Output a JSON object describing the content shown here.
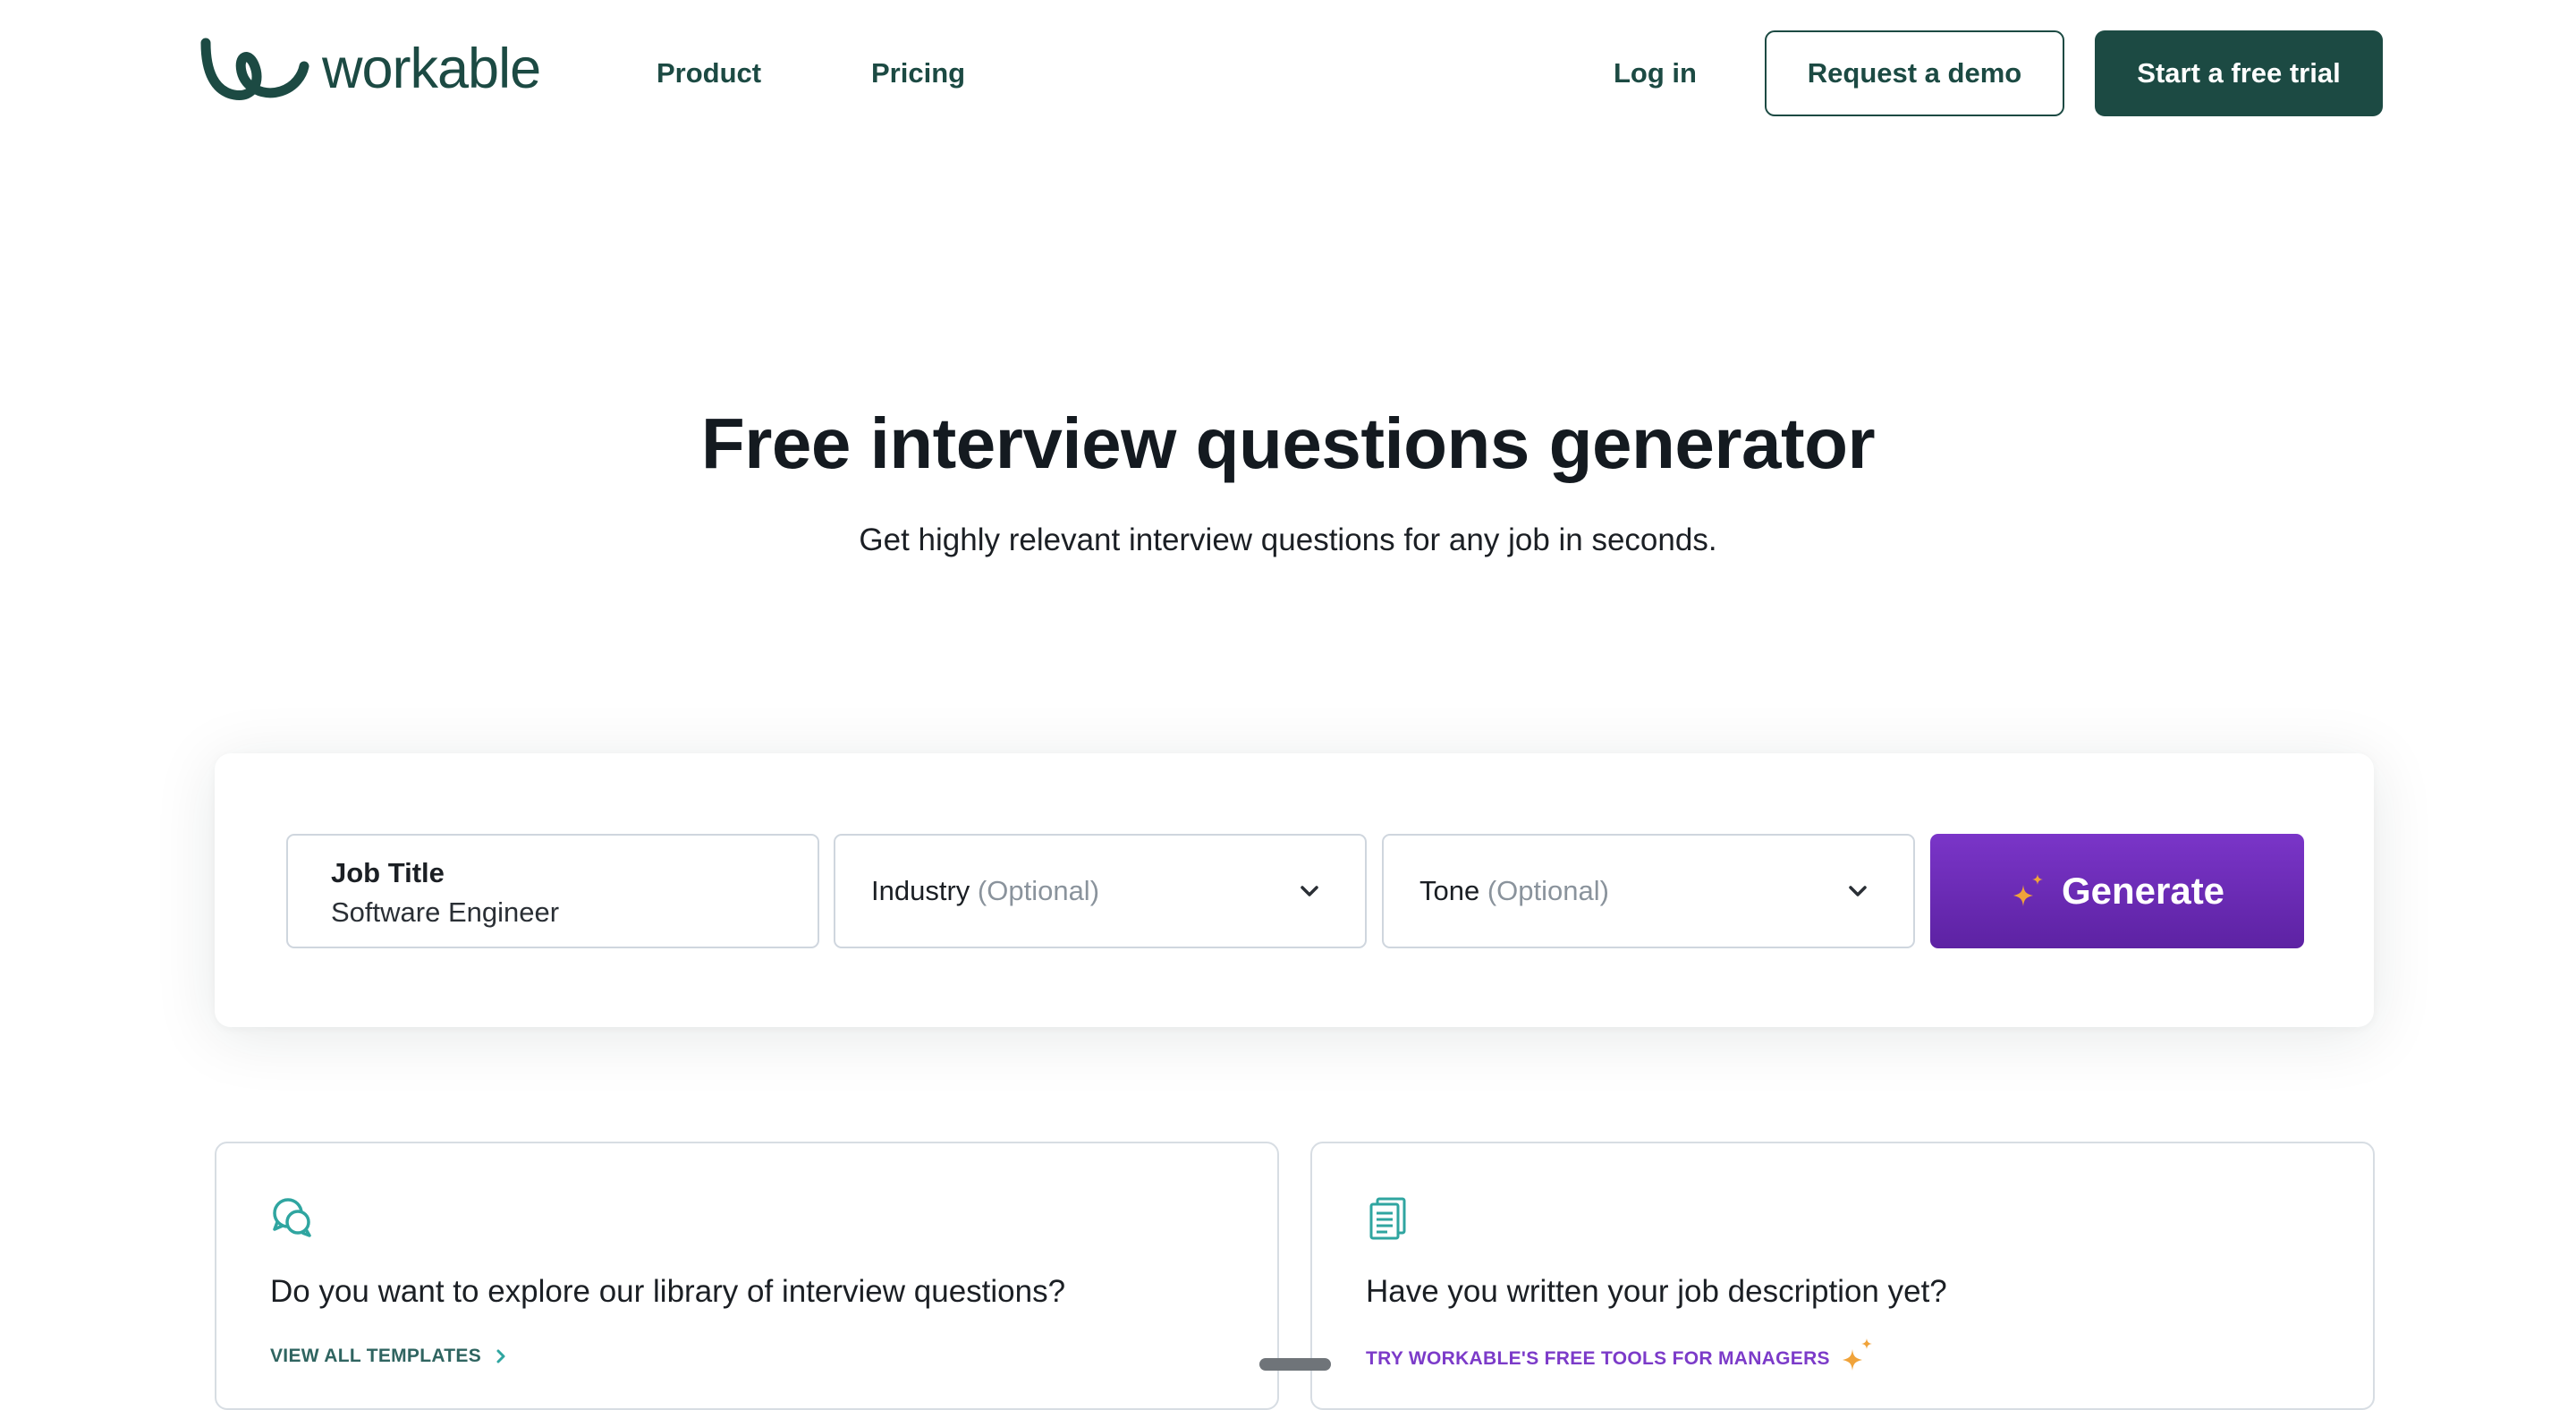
{
  "header": {
    "logo_text": "workable",
    "nav": {
      "product": "Product",
      "pricing": "Pricing",
      "login": "Log in"
    },
    "request_demo": "Request a demo",
    "start_trial": "Start a free trial"
  },
  "hero": {
    "title": "Free interview questions generator",
    "subtitle": "Get highly relevant interview questions for any job in seconds."
  },
  "form": {
    "job_title": {
      "label": "Job Title",
      "value": "Software Engineer"
    },
    "industry": {
      "label": "Industry",
      "optional": "(Optional)"
    },
    "tone": {
      "label": "Tone",
      "optional": "(Optional)"
    },
    "generate_label": "Generate"
  },
  "cards": {
    "library": {
      "icon": "chat-bubbles-icon",
      "title": "Do you want to explore our library of interview questions?",
      "link": "VIEW ALL TEMPLATES"
    },
    "job_description": {
      "icon": "document-icon",
      "title": "Have you written your job description yet?",
      "link": "TRY WORKABLE'S FREE TOOLS FOR MANAGERS"
    }
  },
  "colors": {
    "brand_green": "#1c4a43",
    "generate_purple": "#6a2bb6",
    "accent_teal": "#2fa5a0",
    "spark_orange": "#f0a33a",
    "link_purple": "#7c3bc9"
  }
}
